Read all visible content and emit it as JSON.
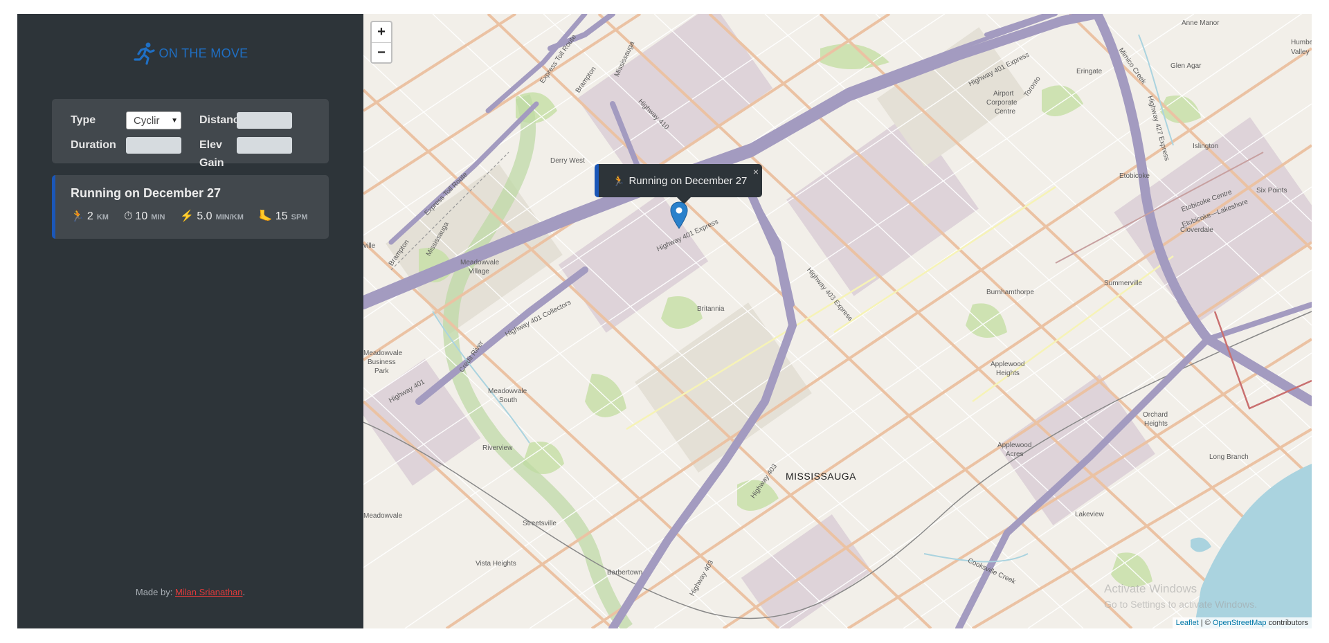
{
  "app": {
    "title": "ON THE MOVE",
    "brand_color": "#1f6fc4",
    "accent_color": "#1b57b8"
  },
  "form": {
    "type_label": "Type",
    "type_value": "Cyclir",
    "distance_label": "Distance",
    "duration_label": "Duration",
    "elev_label": "Elev Gain"
  },
  "workout": {
    "title": "Running on December 27",
    "details": [
      {
        "icon": "🏃",
        "value": "2",
        "unit": "KM"
      },
      {
        "icon": "⏱",
        "value": "10",
        "unit": "MIN"
      },
      {
        "icon": "⚡",
        "value": "5.0",
        "unit": "MIN/KM"
      },
      {
        "icon": "🦶",
        "value": "15",
        "unit": "SPM"
      }
    ]
  },
  "credit": {
    "prefix": "Made by: ",
    "author": "Milan Srianathan",
    "suffix": "."
  },
  "map": {
    "zoom_in": "+",
    "zoom_out": "−",
    "popup_icon": "🏃",
    "popup_text": "Running on December 27",
    "popup_close": "×",
    "labels": {
      "mississauga": "MISSISSAUGA",
      "britannia": "Britannia",
      "meadowvale_village_1": "Meadowvale",
      "meadowvale_village_2": "Village",
      "meadowvale_south_1": "Meadowvale",
      "meadowvale_south_2": "South",
      "business_1": "Meadowvale",
      "business_2": "Business",
      "business_3": "Park",
      "riverview": "Riverview",
      "streetsville": "Streetsville",
      "vista_heights": "Vista Heights",
      "barbertown": "Barbertown",
      "burnhamthorpe": "Burnhamthorpe",
      "applewood_heights_1": "Applewood",
      "applewood_heights_2": "Heights",
      "applewood_acres_1": "Applewood",
      "applewood_acres_2": "Acres",
      "lakeview": "Lakeview",
      "orchard_1": "Orchard",
      "orchard_2": "Heights",
      "long_branch": "Long Branch",
      "cloverdale": "Cloverdale",
      "summerville": "Summerville",
      "etobicoke": "Etobicoke",
      "islington": "Islington",
      "glen_agar": "Glen Agar",
      "eringate": "Eringate",
      "anne_manor": "Anne Manor",
      "humber_1": "Humbe",
      "humber_2": "Valley",
      "airport_1": "Airport",
      "airport_2": "Corporate",
      "airport_3": "Centre",
      "derry_west": "Derry West",
      "meadowvale_left": "Meadowvale",
      "ville": "ville",
      "highway_401_express": "Highway 401 Express",
      "highway_401_collectors": "Highway 401 Collectors",
      "highway_401": "Highway 401",
      "highway_403": "Highway 403",
      "highway_403_express": "Highway 403 Express",
      "highway_410": "Highway 410",
      "highway_427_express": "Highway 427 Express",
      "express_toll_route": "Express Toll Route",
      "mississauga_rd": "Mississauga",
      "brampton": "Brampton",
      "etobicoke_centre": "Etobicoke Centre",
      "etobicoke_lakeshore": "Etobicoke—Lakeshore",
      "six_points": "Six Points",
      "credit_river": "Credit River",
      "cooksville_creek": "Cooksville Creek",
      "mimico_creek": "Mimico Creek",
      "toronto": "Toronto"
    },
    "watermark_title": "Activate Windows",
    "watermark_sub": "Go to Settings to activate Windows.",
    "attribution_leaflet": "Leaflet",
    "attribution_sep": " | © ",
    "attribution_osm": "OpenStreetMap",
    "attribution_suffix": " contributors"
  }
}
